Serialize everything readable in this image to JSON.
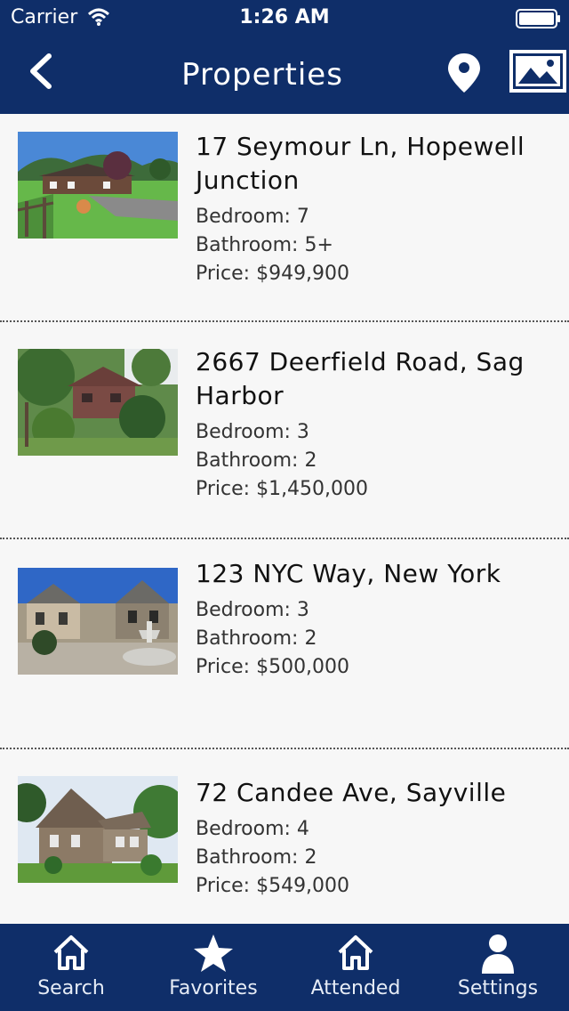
{
  "status_bar": {
    "carrier": "Carrier",
    "time": "1:26 AM"
  },
  "nav": {
    "title": "Properties",
    "back_icon": "chevron-left-icon",
    "map_icon": "map-pin-icon",
    "gallery_icon": "photo-icon"
  },
  "properties": [
    {
      "address": "17 Seymour Ln, Hopewell Junction",
      "bedroom": "Bedroom: 7",
      "bathroom": "Bathroom: 5+",
      "price": "Price: $949,900"
    },
    {
      "address": "2667 Deerfield Road, Sag Harbor",
      "bedroom": "Bedroom: 3",
      "bathroom": "Bathroom: 2",
      "price": "Price: $1,450,000"
    },
    {
      "address": "123 NYC Way, New York",
      "bedroom": "Bedroom: 3",
      "bathroom": "Bathroom: 2",
      "price": "Price: $500,000"
    },
    {
      "address": "72 Candee Ave, Sayville",
      "bedroom": "Bedroom: 4",
      "bathroom": "Bathroom: 2",
      "price": "Price: $549,000"
    }
  ],
  "tabs": [
    {
      "label": "Search",
      "icon": "home-icon"
    },
    {
      "label": "Favorites",
      "icon": "star-icon"
    },
    {
      "label": "Attended",
      "icon": "home-outline-icon"
    },
    {
      "label": "Settings",
      "icon": "person-icon"
    }
  ],
  "colors": {
    "primary": "#0f2e69",
    "background": "#f7f7f7",
    "text": "#111111"
  }
}
